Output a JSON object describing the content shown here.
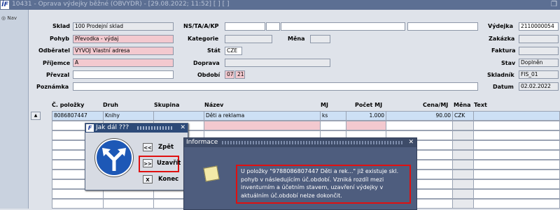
{
  "window": {
    "logo": "İF",
    "title": "10431 - Oprava výdejky běžné (OBVYDR) - [29.08.2022; 11:52] [ ] [ ]",
    "restore_glyph": "❐"
  },
  "leftnav": {
    "label": "Nav"
  },
  "form": {
    "sklad": {
      "label": "Sklad",
      "value": "100 Prodejní sklad"
    },
    "pohyb": {
      "label": "Pohyb",
      "value": "Převodka - výdaj"
    },
    "odberatel": {
      "label": "Odběratel",
      "value": "VYVOJ Vlastní adresa"
    },
    "prijemce": {
      "label": "Příjemce",
      "value": "A"
    },
    "prevzal": {
      "label": "Převzal",
      "value": ""
    },
    "poznamka": {
      "label": "Poznámka",
      "value": ""
    },
    "nstaakp": {
      "label": "NS/TA/A/KP"
    },
    "kategorie": {
      "label": "Kategorie"
    },
    "mena": {
      "label": "Měna"
    },
    "stat": {
      "label": "Stát",
      "value": "CZE"
    },
    "doprava": {
      "label": "Doprava"
    },
    "obdobi": {
      "label": "Období",
      "value1": "07",
      "value2": "21"
    },
    "vydejka": {
      "label": "Výdejka",
      "value": "2110000054"
    },
    "zakazka": {
      "label": "Zakázka"
    },
    "faktura": {
      "label": "Faktura"
    },
    "stav": {
      "label": "Stav",
      "value": "Doplněn"
    },
    "skladnik": {
      "label": "Skladník",
      "value": "FIS_01"
    },
    "datum": {
      "label": "Datum",
      "value": "02.02.2022"
    }
  },
  "table": {
    "headers": {
      "polozky": "Č. položky",
      "druh": "Druh",
      "skupina": "Skupina",
      "nazev": "Název",
      "mj": "MJ",
      "pocet": "Počet MJ",
      "cena": "Cena/MJ",
      "mena": "Měna",
      "text": "Text"
    },
    "rows": [
      {
        "polozka": "8086807447",
        "druh": "Knihy",
        "skupina": "",
        "nazev": "Děti a reklama",
        "mj": "ks",
        "pocet": "1.000",
        "cena": "90.00",
        "mena": "CZK",
        "text": ""
      }
    ]
  },
  "dialog_next": {
    "title": "Jak dál ???",
    "close": "✕",
    "back_btn": "<<",
    "back_label": "Zpět",
    "close_btn": ">>",
    "close_label": "Uzavřít",
    "end_btn": "X",
    "end_label": "Konec"
  },
  "dialog_info": {
    "title": "Informace",
    "close": "✕",
    "message": "U položky \"9788086807447 Děti a rek...\" již existuje skl. pohyb v následujícím úč.období. Vzniká rozdíl mezi inventurním a účetním stavem, uzavření výdejky v aktuálním úč.období nelze dokončit."
  },
  "colors": {
    "title_bar": "#5c6f93",
    "required_field": "#f3c9cf",
    "highlight_border": "#e01010",
    "dialog_bg": "#4e5d7e"
  }
}
